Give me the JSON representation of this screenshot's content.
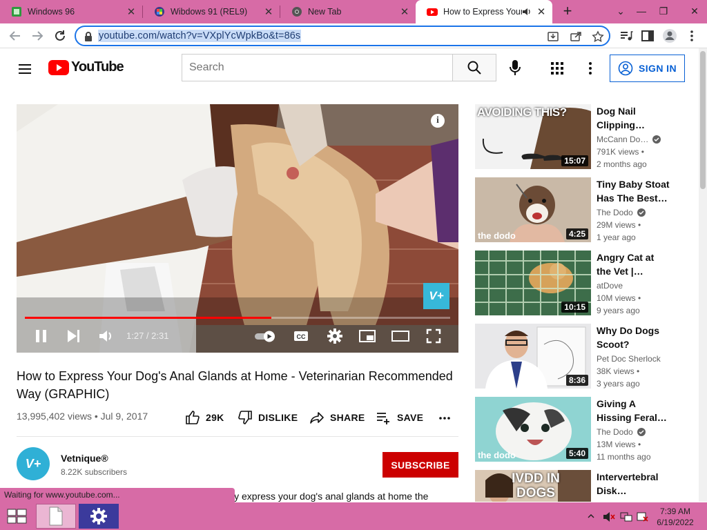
{
  "browser": {
    "tabs": [
      {
        "title": "Windows 96",
        "icon": "windows-96-icon"
      },
      {
        "title": "Wibdows 91 (REL9)",
        "icon": "wibdows-icon"
      },
      {
        "title": "New Tab",
        "icon": "chrome-icon"
      },
      {
        "title": "How to Express Your",
        "icon": "youtube-icon",
        "active": true
      }
    ],
    "url": "youtube.com/watch?v=VXplYcWpkBo&t=86s",
    "status_text": "Waiting for www.youtube.com..."
  },
  "youtube": {
    "logo_text": "YouTube",
    "search_placeholder": "Search",
    "sign_in_label": "SIGN IN"
  },
  "player": {
    "time": "1:27 / 2:31",
    "progress": 0.58,
    "watermark": "V+"
  },
  "video": {
    "title": "How to Express Your Dog's Anal Glands at Home - Veterinarian Recommended Way (GRAPHIC)",
    "views_date": "13,995,402 views • Jul 9, 2017",
    "likes": "29K",
    "dislike_label": "DISLIKE",
    "share_label": "SHARE",
    "save_label": "SAVE",
    "channel": "Vetnique®",
    "subscribers": "8.22K subscribers",
    "subscribe_label": "SUBSCRIBE",
    "description_snippet": "ly express your dog's anal glands at home the"
  },
  "recommendations": [
    {
      "title": "Dog Nail Clipping…",
      "channel": "McCann Do…",
      "verified": true,
      "views": "791K views •",
      "age": "2 months ago",
      "duration": "15:07",
      "overlay": "AVOIDING THIS?"
    },
    {
      "title": "Tiny Baby Stoat Has The Best…",
      "channel": "The Dodo",
      "verified": true,
      "views": "29M views •",
      "age": "1 year ago",
      "duration": "4:25",
      "overlay": "the dodo"
    },
    {
      "title": "Angry Cat at the Vet |…",
      "channel": "atDove",
      "verified": false,
      "views": "10M views •",
      "age": "9 years ago",
      "duration": "10:15",
      "overlay": ""
    },
    {
      "title": "Why Do Dogs Scoot?",
      "channel": "Pet Doc Sherlock",
      "verified": false,
      "views": "38K views •",
      "age": "3 years ago",
      "duration": "8:36",
      "overlay": ""
    },
    {
      "title": "Giving A Hissing Feral…",
      "channel": "The Dodo",
      "verified": true,
      "views": "13M views •",
      "age": "11 months ago",
      "duration": "5:40",
      "overlay": "the dodo"
    },
    {
      "title": "Intervertebral Disk…",
      "channel": "",
      "verified": false,
      "views": "",
      "age": "",
      "duration": "",
      "overlay": "IVDD IN DOGS"
    }
  ],
  "taskbar": {
    "time": "7:39 AM",
    "date": "6/19/2022"
  },
  "colors": {
    "theme_pink": "#d76ba6",
    "youtube_red": "#ff0000",
    "subscribe_red": "#cc0000",
    "link_blue": "#065fd4"
  }
}
